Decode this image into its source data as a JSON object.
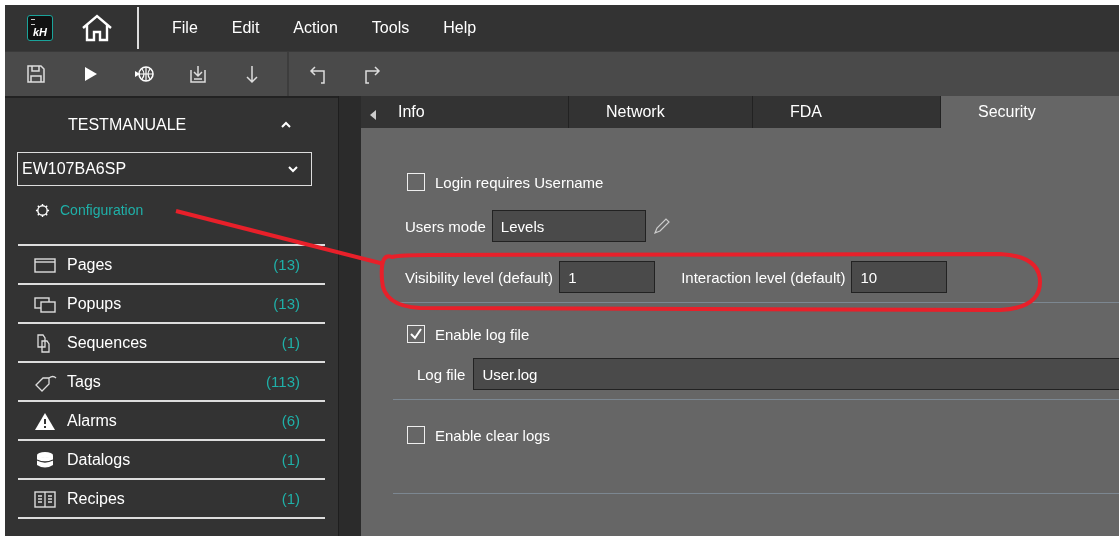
{
  "logo": {
    "text": "kH"
  },
  "menu": [
    "File",
    "Edit",
    "Action",
    "Tools",
    "Help"
  ],
  "project": {
    "name": "TESTMANUALE",
    "device": "EW107BA6SP",
    "configuration": "Configuration"
  },
  "sidebar": {
    "items": [
      {
        "kind": "pages",
        "label": "Pages",
        "count": "(13)"
      },
      {
        "kind": "popups",
        "label": "Popups",
        "count": "(13)"
      },
      {
        "kind": "sequences",
        "label": "Sequences",
        "count": "(1)"
      },
      {
        "kind": "tags",
        "label": "Tags",
        "count": "(113)"
      },
      {
        "kind": "alarms",
        "label": "Alarms",
        "count": "(6)"
      },
      {
        "kind": "datalogs",
        "label": "Datalogs",
        "count": "(1)"
      },
      {
        "kind": "recipes",
        "label": "Recipes",
        "count": "(1)"
      }
    ]
  },
  "tabs": [
    {
      "label": "Info",
      "selected": false
    },
    {
      "label": "Network",
      "selected": false
    },
    {
      "label": "FDA",
      "selected": false
    },
    {
      "label": "Security",
      "selected": true
    }
  ],
  "security": {
    "login_requires_username": {
      "label": "Login requires Username",
      "checked": false
    },
    "users_mode": {
      "label": "Users mode",
      "value": "Levels"
    },
    "visibility_level": {
      "label": "Visibility level (default)",
      "value": "1"
    },
    "interaction_level": {
      "label": "Interaction level (default)",
      "value": "10"
    },
    "enable_log_file": {
      "label": "Enable log file",
      "checked": true
    },
    "log_file": {
      "label": "Log file",
      "value": "User.log"
    },
    "enable_clear_logs": {
      "label": "Enable clear logs",
      "checked": false
    }
  }
}
